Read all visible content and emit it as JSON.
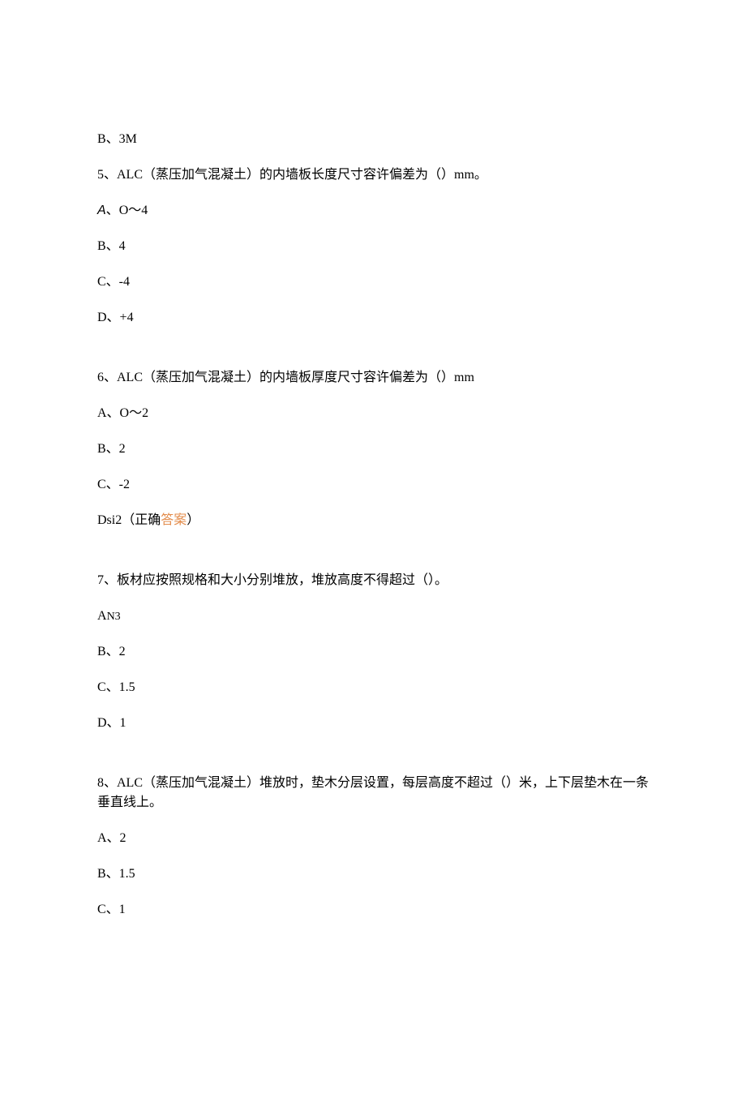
{
  "orphan_option": "B、3M",
  "q5": {
    "stem": "5、ALC（蒸压加气混凝土）的内墙板长度尺寸容许偏差为（）mm。",
    "optA_label": "A",
    "optA_punct": "、",
    "optA_val": "O～4",
    "optB": "B、4",
    "optC": "C、-4",
    "optD": "D、+4"
  },
  "q6": {
    "stem": "6、ALC（蒸压加气混凝土）的内墙板厚度尺寸容许偏差为（）mm",
    "optA": "A、O～2",
    "optB": "B、2",
    "optC": "C、-2",
    "optD_prefix": "Dsi2",
    "optD_paren_open": "（正确",
    "optD_answer": "答案",
    "optD_paren_close": "）"
  },
  "q7": {
    "stem": "7、板材应按照规格和大小分别堆放，堆放高度不得超过（）。",
    "optA_prefix": "A",
    "optA_suffix": "N3",
    "optB": "B、2",
    "optC": "C、1.5",
    "optD": "D、1"
  },
  "q8": {
    "stem": "8、ALC（蒸压加气混凝土）堆放时，垫木分层设置，每层高度不超过（）米，上下层垫木在一条垂直线上。",
    "optA": "A、2",
    "optB": "B、1.5",
    "optC": "C、1"
  }
}
